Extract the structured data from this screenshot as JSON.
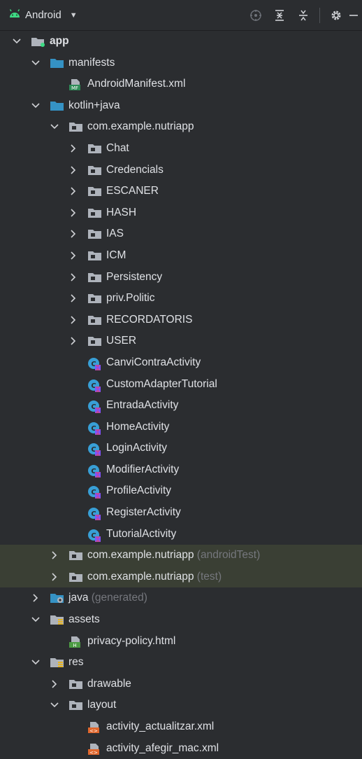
{
  "toolbar": {
    "title": "Android",
    "icons": [
      "android-icon",
      "chevron-down-icon",
      "locate-icon",
      "expand-all-icon",
      "collapse-all-icon",
      "gear-icon",
      "minimize-icon"
    ]
  },
  "colors": {
    "background": "#2b2d30",
    "highlight_row": "#3a3f34",
    "folder_blue": "#3592c4",
    "folder_gray": "#aeb3bb",
    "kotlin_badge": "#7f52ff",
    "class_circle": "#389fd6",
    "manifest_green": "#2e8b57",
    "xml_orange": "#e0672d",
    "suffix_gray": "#75777d"
  },
  "tree": [
    {
      "label": "app",
      "suffix": "",
      "level": 0,
      "icon": "module-folder-icon",
      "arrow": "expanded",
      "bold": true
    },
    {
      "label": "manifests",
      "suffix": "",
      "level": 1,
      "icon": "blue-folder-icon",
      "arrow": "expanded"
    },
    {
      "label": "AndroidManifest.xml",
      "suffix": "",
      "level": 2,
      "icon": "manifest-file-icon",
      "arrow": "none"
    },
    {
      "label": "kotlin+java",
      "suffix": "",
      "level": 1,
      "icon": "blue-folder-icon",
      "arrow": "expanded"
    },
    {
      "label": "com.example.nutriapp",
      "suffix": "",
      "level": 2,
      "icon": "package-icon",
      "arrow": "expanded"
    },
    {
      "label": "Chat",
      "suffix": "",
      "level": 3,
      "icon": "package-icon",
      "arrow": "collapsed"
    },
    {
      "label": "Credencials",
      "suffix": "",
      "level": 3,
      "icon": "package-icon",
      "arrow": "collapsed"
    },
    {
      "label": "ESCANER",
      "suffix": "",
      "level": 3,
      "icon": "package-icon",
      "arrow": "collapsed"
    },
    {
      "label": "HASH",
      "suffix": "",
      "level": 3,
      "icon": "package-icon",
      "arrow": "collapsed"
    },
    {
      "label": "IAS",
      "suffix": "",
      "level": 3,
      "icon": "package-icon",
      "arrow": "collapsed"
    },
    {
      "label": "ICM",
      "suffix": "",
      "level": 3,
      "icon": "package-icon",
      "arrow": "collapsed"
    },
    {
      "label": "Persistency",
      "suffix": "",
      "level": 3,
      "icon": "package-icon",
      "arrow": "collapsed"
    },
    {
      "label": "priv.Politic",
      "suffix": "",
      "level": 3,
      "icon": "package-icon",
      "arrow": "collapsed"
    },
    {
      "label": "RECORDATORIS",
      "suffix": "",
      "level": 3,
      "icon": "package-icon",
      "arrow": "collapsed"
    },
    {
      "label": "USER",
      "suffix": "",
      "level": 3,
      "icon": "package-icon",
      "arrow": "collapsed"
    },
    {
      "label": "CanviContraActivity",
      "suffix": "",
      "level": 3,
      "icon": "kotlin-class-icon",
      "arrow": "none"
    },
    {
      "label": "CustomAdapterTutorial",
      "suffix": "",
      "level": 3,
      "icon": "kotlin-class-icon",
      "arrow": "none"
    },
    {
      "label": "EntradaActivity",
      "suffix": "",
      "level": 3,
      "icon": "kotlin-class-icon",
      "arrow": "none"
    },
    {
      "label": "HomeActivity",
      "suffix": "",
      "level": 3,
      "icon": "kotlin-class-icon",
      "arrow": "none"
    },
    {
      "label": "LoginActivity",
      "suffix": "",
      "level": 3,
      "icon": "kotlin-class-icon",
      "arrow": "none"
    },
    {
      "label": "ModifierActivity",
      "suffix": "",
      "level": 3,
      "icon": "kotlin-class-icon",
      "arrow": "none"
    },
    {
      "label": "ProfileActivity",
      "suffix": "",
      "level": 3,
      "icon": "kotlin-class-icon",
      "arrow": "none"
    },
    {
      "label": "RegisterActivity",
      "suffix": "",
      "level": 3,
      "icon": "kotlin-class-icon",
      "arrow": "none"
    },
    {
      "label": "TutorialActivity",
      "suffix": "",
      "level": 3,
      "icon": "kotlin-class-icon",
      "arrow": "none"
    },
    {
      "label": "com.example.nutriapp",
      "suffix": " (androidTest)",
      "level": 2,
      "icon": "package-icon",
      "arrow": "collapsed",
      "highlight": true
    },
    {
      "label": "com.example.nutriapp",
      "suffix": " (test)",
      "level": 2,
      "icon": "package-icon",
      "arrow": "collapsed",
      "highlight": true
    },
    {
      "label": "java",
      "suffix": " (generated)",
      "level": 1,
      "icon": "generated-folder-icon",
      "arrow": "collapsed"
    },
    {
      "label": "assets",
      "suffix": "",
      "level": 1,
      "icon": "resource-folder-icon",
      "arrow": "expanded"
    },
    {
      "label": "privacy-policy.html",
      "suffix": "",
      "level": 2,
      "icon": "html-file-icon",
      "arrow": "none"
    },
    {
      "label": "res",
      "suffix": "",
      "level": 1,
      "icon": "resource-folder-icon",
      "arrow": "expanded"
    },
    {
      "label": "drawable",
      "suffix": "",
      "level": 2,
      "icon": "package-icon",
      "arrow": "collapsed"
    },
    {
      "label": "layout",
      "suffix": "",
      "level": 2,
      "icon": "package-icon",
      "arrow": "expanded"
    },
    {
      "label": "activity_actualitzar.xml",
      "suffix": "",
      "level": 3,
      "icon": "layout-xml-icon",
      "arrow": "none"
    },
    {
      "label": "activity_afegir_mac.xml",
      "suffix": "",
      "level": 3,
      "icon": "layout-xml-icon",
      "arrow": "none"
    }
  ]
}
